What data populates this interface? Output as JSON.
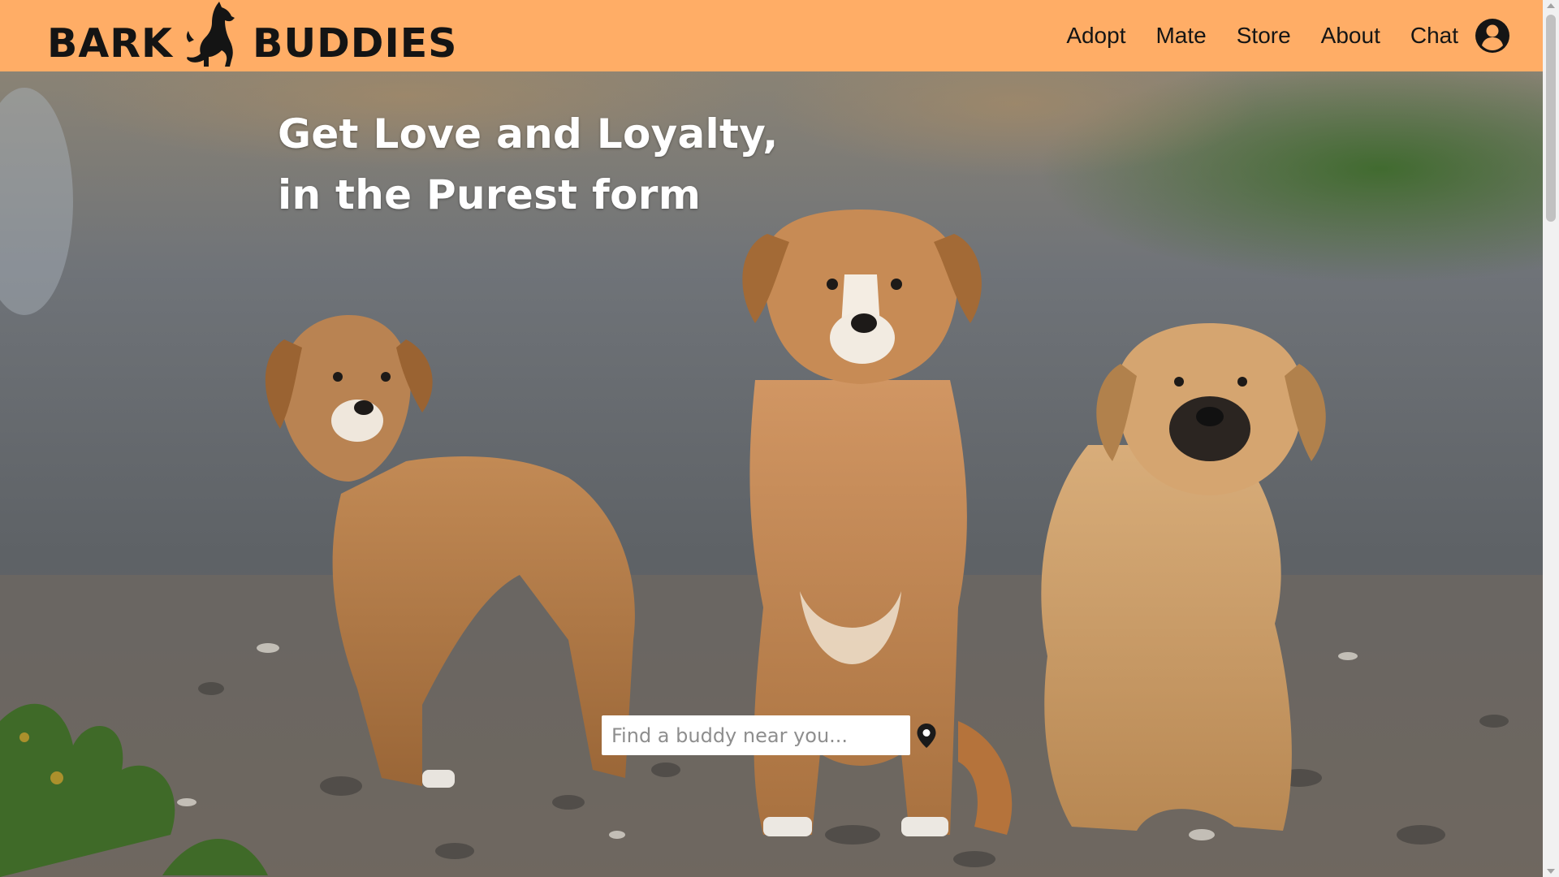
{
  "brand": {
    "word_left": "BARK",
    "word_right": "BUDDIES",
    "logo_icon": "dog-silhouette-icon"
  },
  "nav": {
    "items": [
      "Adopt",
      "Mate",
      "Store",
      "About",
      "Chat"
    ],
    "account_icon": "user-circle-icon"
  },
  "hero": {
    "headline_line1": "Get Love and Loyalty,",
    "headline_line2": "in the Purest form",
    "search_placeholder": "Find a buddy near you...",
    "location_icon": "map-pin-icon"
  },
  "colors": {
    "header_bg": "#ffad66",
    "text_dark": "#151515",
    "headline": "#ffffff"
  }
}
